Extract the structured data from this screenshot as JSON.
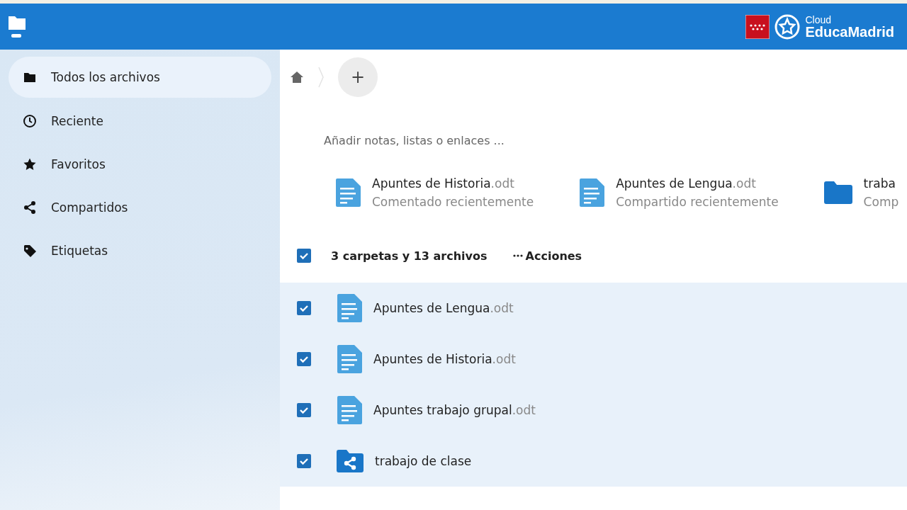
{
  "header": {
    "logo": {
      "small": "Cloud",
      "big": "EducaMadrid"
    }
  },
  "sidebar": {
    "items": [
      {
        "label": "Todos los archivos",
        "kind": "folder",
        "selected": true
      },
      {
        "label": "Reciente",
        "kind": "clock",
        "selected": false
      },
      {
        "label": "Favoritos",
        "kind": "star",
        "selected": false
      },
      {
        "label": "Compartidos",
        "kind": "share",
        "selected": false
      },
      {
        "label": "Etiquetas",
        "kind": "tag",
        "selected": false
      }
    ]
  },
  "breadcrumb": {
    "new_button": "+"
  },
  "notes": {
    "placeholder": "Añadir notas, listas o enlaces ..."
  },
  "recommendations": [
    {
      "kind": "file",
      "name": "Apuntes de Historia",
      "ext": ".odt",
      "reason": "Comentado recientemente"
    },
    {
      "kind": "file",
      "name": "Apuntes de Lengua",
      "ext": ".odt",
      "reason": "Compartido recientemente"
    },
    {
      "kind": "folder",
      "name": "traba",
      "reason": "Comp"
    }
  ],
  "files": {
    "select_all": {
      "checked": true
    },
    "summary": "3 carpetas y 13 archivos",
    "actions": "Acciones",
    "rows": [
      {
        "kind": "file",
        "name": "Apuntes de Lengua",
        "ext": ".odt",
        "selected": true
      },
      {
        "kind": "file",
        "name": "Apuntes de Historia",
        "ext": ".odt",
        "selected": true
      },
      {
        "kind": "file",
        "name": "Apuntes trabajo grupal",
        "ext": ".odt",
        "selected": true
      },
      {
        "kind": "shared-folder",
        "name": "trabajo de clase",
        "selected": true
      }
    ]
  }
}
